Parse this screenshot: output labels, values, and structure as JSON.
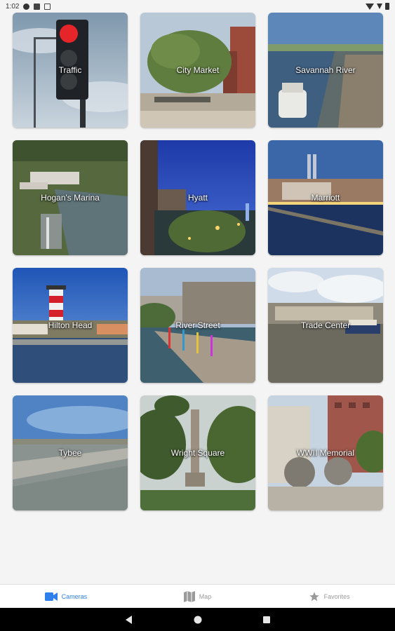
{
  "status_bar": {
    "time": "1:02"
  },
  "tiles": [
    {
      "label": "Traffic"
    },
    {
      "label": "City Market"
    },
    {
      "label": "Savannah River"
    },
    {
      "label": "Hogan's Marina"
    },
    {
      "label": "Hyatt"
    },
    {
      "label": "Marriott"
    },
    {
      "label": "Hilton Head"
    },
    {
      "label": "River Street"
    },
    {
      "label": "Trade Center"
    },
    {
      "label": "Tybee"
    },
    {
      "label": "Wright Square"
    },
    {
      "label": "WWII Memorial"
    }
  ],
  "bottom_nav": {
    "active_color": "#2f80ed",
    "items": [
      {
        "label": "Cameras",
        "icon": "video-camera-icon",
        "active": true
      },
      {
        "label": "Map",
        "icon": "map-icon",
        "active": false
      },
      {
        "label": "Favorites",
        "icon": "star-icon",
        "active": false
      }
    ]
  },
  "system_nav": {
    "icons": [
      "back-icon",
      "home-icon",
      "recents-icon"
    ]
  }
}
